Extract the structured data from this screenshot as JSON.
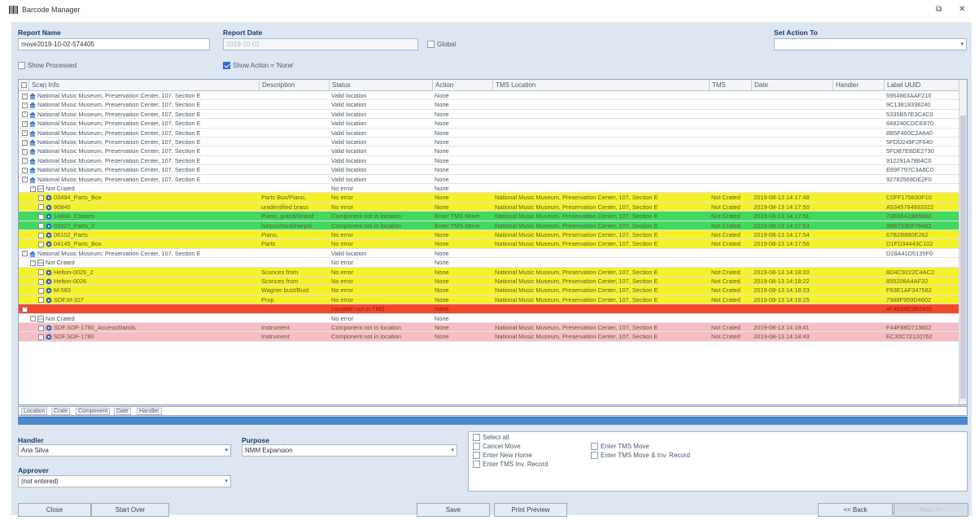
{
  "window": {
    "title": "Barcode Manager",
    "restore_glyph": "⧉",
    "close_glyph": "✕"
  },
  "form": {
    "report_name_label": "Report Name",
    "report_name_value": "move2019-10-02-574405",
    "report_date_label": "Report Date",
    "report_date_value": "2019-10-02",
    "global_label": "Global",
    "set_action_label": "Set Action To",
    "set_action_value": "",
    "show_processed_label": "Show Processed",
    "show_action_none_label": "Show Action = 'None'"
  },
  "grid": {
    "columns": [
      "Scan Info",
      "Description",
      "Status",
      "Action",
      "TMS Location",
      "TMS",
      "Date",
      "Handler",
      "Label UUID"
    ],
    "rows": [
      {
        "style": "white",
        "indent": 0,
        "node": "loc",
        "scan": "National Music Museum, Preservation Center, 107, Section E",
        "desc": "",
        "status": "Valid location",
        "action": "None",
        "loc": "",
        "tms": "",
        "date": "",
        "handler": "",
        "uuid": "5954863AAF210"
      },
      {
        "style": "white",
        "indent": 0,
        "node": "loc",
        "scan": "National Music Museum, Preservation Center, 107, Section E",
        "desc": "",
        "status": "Valid location",
        "action": "None",
        "loc": "",
        "tms": "",
        "date": "",
        "handler": "",
        "uuid": "9C13818338240"
      },
      {
        "style": "white",
        "indent": 0,
        "node": "loc",
        "scan": "National Music Museum, Preservation Center, 107, Section E",
        "desc": "",
        "status": "Valid location",
        "action": "None",
        "loc": "",
        "tms": "",
        "date": "",
        "handler": "",
        "uuid": "5335B57E3C4C0"
      },
      {
        "style": "white",
        "indent": 0,
        "node": "loc",
        "scan": "National Music Museum, Preservation Center, 107, Section E",
        "desc": "",
        "status": "Valid location",
        "action": "None",
        "loc": "",
        "tms": "",
        "date": "",
        "handler": "",
        "uuid": "848240CDCE870"
      },
      {
        "style": "white",
        "indent": 0,
        "node": "loc",
        "scan": "National Music Museum, Preservation Center, 107, Section E",
        "desc": "",
        "status": "Valid location",
        "action": "None",
        "loc": "",
        "tms": "",
        "date": "",
        "handler": "",
        "uuid": "8B5F460C2A640"
      },
      {
        "style": "white",
        "indent": 0,
        "node": "loc",
        "scan": "National Music Museum, Preservation Center, 107, Section E",
        "desc": "",
        "status": "Valid location",
        "action": "None",
        "loc": "",
        "tms": "",
        "date": "",
        "handler": "",
        "uuid": "5FDD249F2F640"
      },
      {
        "style": "white",
        "indent": 0,
        "node": "loc",
        "scan": "National Music Museum, Preservation Center, 107, Section E",
        "desc": "",
        "status": "Valid location",
        "action": "None",
        "loc": "",
        "tms": "",
        "date": "",
        "handler": "",
        "uuid": "5FDB7E8DE2730"
      },
      {
        "style": "white",
        "indent": 0,
        "node": "loc",
        "scan": "National Music Museum, Preservation Center, 107, Section E",
        "desc": "",
        "status": "Valid location",
        "action": "None",
        "loc": "",
        "tms": "",
        "date": "",
        "handler": "",
        "uuid": "912291A7884C0"
      },
      {
        "style": "white",
        "indent": 0,
        "node": "loc",
        "scan": "National Music Museum, Preservation Center, 107, Section E",
        "desc": "",
        "status": "Valid location",
        "action": "None",
        "loc": "",
        "tms": "",
        "date": "",
        "handler": "",
        "uuid": "E69F797C3A8C0"
      },
      {
        "style": "white",
        "indent": 0,
        "node": "loc",
        "scan": "National Music Museum, Preservation Center, 107, Section E",
        "desc": "",
        "status": "Valid location",
        "action": "None",
        "loc": "",
        "tms": "",
        "date": "",
        "handler": "",
        "uuid": "92782569DE2F0"
      },
      {
        "style": "white",
        "indent": 1,
        "node": "crate",
        "scan": "Not Crated",
        "desc": "",
        "status": "No error",
        "action": "None",
        "loc": "",
        "tms": "",
        "date": "",
        "handler": "",
        "uuid": ""
      },
      {
        "style": "yellow",
        "indent": 2,
        "node": "item",
        "scan": "03494_Parts_Box",
        "desc": "Parts Box/Piano,",
        "status": "No error",
        "action": "None",
        "loc": "National Music Museum, Preservation Center, 107, Section E",
        "tms": "Not Crated",
        "date": "2019-08-13 14:17:48",
        "handler": "",
        "uuid": "C0FF175830F10"
      },
      {
        "style": "yellow",
        "indent": 2,
        "node": "item",
        "scan": "90840",
        "desc": "unidentified brass",
        "status": "No error",
        "action": "None",
        "loc": "National Music Museum, Preservation Center, 107, Section E",
        "tms": "Not Crated",
        "date": "2019-08-13 14:17:50",
        "handler": "",
        "uuid": "A5345784933322"
      },
      {
        "style": "green",
        "indent": 2,
        "node": "item",
        "scan": "14800_Casters",
        "desc": "Piano, grand/Grand",
        "status": "Component not in location",
        "action": "Enter TMS Move",
        "loc": "National Music Museum, Preservation Center, 107, Section E",
        "tms": "Not Crated",
        "date": "2019-08-13 14:17:51",
        "handler": "",
        "uuid": "73E66A1B85602"
      },
      {
        "style": "green",
        "indent": 2,
        "node": "item",
        "scan": "03327_Parts_2",
        "desc": "harpsichord/Harpsi",
        "status": "Component not in location",
        "action": "Enter TMS Move",
        "loc": "National Music Museum, Preservation Center, 107, Section E",
        "tms": "Not Crated",
        "date": "2019-08-13 14:17:53",
        "handler": "",
        "uuid": "9B8733EF76462"
      },
      {
        "style": "yellow",
        "indent": 2,
        "node": "item",
        "scan": "06102_Parts",
        "desc": "Piano,",
        "status": "No error",
        "action": "None",
        "loc": "National Music Museum, Preservation Center, 107, Section E",
        "tms": "Not Crated",
        "date": "2019-08-13 14:17:54",
        "handler": "",
        "uuid": "67B2B890E262"
      },
      {
        "style": "yellow",
        "indent": 2,
        "node": "item",
        "scan": "04145_Parts_Box",
        "desc": "Parts",
        "status": "No error",
        "action": "None",
        "loc": "National Music Museum, Preservation Center, 107, Section E",
        "tms": "Not Crated",
        "date": "2019-08-13 14:17:56",
        "handler": "",
        "uuid": "D1FD34443C102"
      },
      {
        "style": "white",
        "indent": 0,
        "node": "loc",
        "scan": "National Music Museum, Preservation Center, 107, Section E",
        "desc": "",
        "status": "Valid location",
        "action": "None",
        "loc": "",
        "tms": "",
        "date": "",
        "handler": "",
        "uuid": "D28A41D5135F0"
      },
      {
        "style": "white",
        "indent": 1,
        "node": "crate",
        "scan": "Not Crated",
        "desc": "",
        "status": "No error",
        "action": "None",
        "loc": "",
        "tms": "",
        "date": "",
        "handler": "",
        "uuid": ""
      },
      {
        "style": "yellow",
        "indent": 2,
        "node": "item",
        "scan": "Helton-0026_2",
        "desc": "Sconces from",
        "status": "No error",
        "action": "None",
        "loc": "National Music Museum, Preservation Center, 107, Section E",
        "tms": "Not Crated",
        "date": "2019-08-13 14:18:20",
        "handler": "",
        "uuid": "8D4C9222C4AC2"
      },
      {
        "style": "yellow",
        "indent": 2,
        "node": "item",
        "scan": "Helton-0026",
        "desc": "Sconces from",
        "status": "No error",
        "action": "None",
        "loc": "National Music Museum, Preservation Center, 107, Section E",
        "tms": "Not Crated",
        "date": "2019-08-13 14:18:22",
        "handler": "",
        "uuid": "855208A4AF32"
      },
      {
        "style": "yellow",
        "indent": 2,
        "node": "item",
        "scan": "M-583",
        "desc": "Wagner bust/Bust",
        "status": "No error",
        "action": "None",
        "loc": "National Music Museum, Preservation Center, 107, Section E",
        "tms": "Not Crated",
        "date": "2019-08-13 14:18:23",
        "handler": "",
        "uuid": "F63E1AF347582"
      },
      {
        "style": "yellow",
        "indent": 2,
        "node": "item",
        "scan": "SDF.M-327",
        "desc": "Prop",
        "status": "No error",
        "action": "None",
        "loc": "National Music Museum, Preservation Center, 107, Section E",
        "tms": "Not Crated",
        "date": "2019-08-13 14:18:25",
        "handler": "",
        "uuid": "7988F959D4602"
      },
      {
        "style": "red",
        "indent": 0,
        "node": "blank",
        "scan": "",
        "desc": "",
        "status": "Location not in TMS",
        "action": "None",
        "loc": "",
        "tms": "",
        "date": "",
        "handler": "",
        "uuid": "4F4E89C387420"
      },
      {
        "style": "white",
        "indent": 1,
        "node": "crate",
        "scan": "Not Crated",
        "desc": "",
        "status": "No error",
        "action": "None",
        "loc": "",
        "tms": "",
        "date": "",
        "handler": "",
        "uuid": ""
      },
      {
        "style": "pink",
        "indent": 2,
        "node": "item",
        "scan": "SDF.SDF-1780_AccessStands",
        "desc": "Instrument",
        "status": "Component not in location",
        "action": "None",
        "loc": "National Music Museum, Preservation Center, 107, Section E",
        "tms": "Not Crated",
        "date": "2019-08-13 14:18:41",
        "handler": "",
        "uuid": "F44F88D713602"
      },
      {
        "style": "pink",
        "indent": 2,
        "node": "item",
        "scan": "SDF.SDF-1780",
        "desc": "Instrument",
        "status": "Component not in location",
        "action": "None",
        "loc": "National Music Museum, Preservation Center, 107, Section E",
        "tms": "Not Crated",
        "date": "2019-08-13 14:18:43",
        "handler": "",
        "uuid": "EC30C72120762"
      }
    ]
  },
  "group_bar": [
    "Location",
    "Crate",
    "Component",
    "Date",
    "Handler"
  ],
  "bottom": {
    "handler_label": "Handler",
    "handler_value": "Ana Silva",
    "purpose_label": "Purpose",
    "purpose_value": "NMM Expansion",
    "approver_label": "Approver",
    "approver_value": "(not entered)",
    "select_all": "Select all",
    "options": [
      "Cancel Move",
      "Enter New Home",
      "Enter TMS Inv. Record",
      "Enter TMS Move",
      "Enter TMS Move & Inv. Record"
    ]
  },
  "buttons": {
    "close": "Close",
    "start_over": "Start Over",
    "save": "Save",
    "print_preview": "Print Preview",
    "back": "<< Back",
    "next": "Next >>"
  }
}
